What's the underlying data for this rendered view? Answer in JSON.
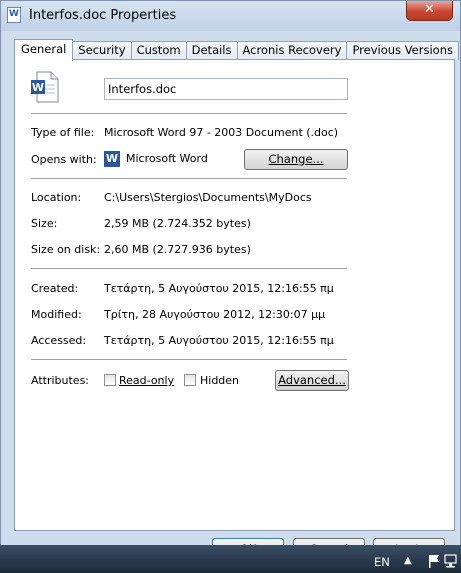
{
  "window": {
    "title": "Interfos.doc Properties",
    "close_glyph": "✕"
  },
  "tabs": [
    {
      "label": "General",
      "active": true
    },
    {
      "label": "Security"
    },
    {
      "label": "Custom"
    },
    {
      "label": "Details"
    },
    {
      "label": "Acronis Recovery"
    },
    {
      "label": "Previous Versions"
    }
  ],
  "general": {
    "filename": "Interfos.doc",
    "type_label": "Type of file:",
    "type_value": "Microsoft Word 97 - 2003 Document (.doc)",
    "opens_label": "Opens with:",
    "opens_value": "Microsoft Word",
    "change_button": "Change...",
    "location_label": "Location:",
    "location_value": "C:\\Users\\Stergios\\Documents\\MyDocs",
    "size_label": "Size:",
    "size_value": "2,59 MB (2.724.352 bytes)",
    "size_on_disk_label": "Size on disk:",
    "size_on_disk_value": "2,60 MB (2.727.936 bytes)",
    "created_label": "Created:",
    "created_value": "Τετάρτη, 5 Αυγούστου 2015, 12:16:55 πμ",
    "modified_label": "Modified:",
    "modified_value": "Τρίτη, 28 Αυγούστου 2012, 12:30:07 μμ",
    "accessed_label": "Accessed:",
    "accessed_value": "Τετάρτη, 5 Αυγούστου 2015, 12:16:55 πμ",
    "attributes_label": "Attributes:",
    "readonly_label": "Read-only",
    "hidden_label": "Hidden",
    "advanced_button": "Advanced..."
  },
  "dialog_buttons": {
    "ok": "OK",
    "cancel": "Cancel",
    "apply": "Apply"
  },
  "taskbar": {
    "language": "EN"
  },
  "colors": {
    "frame": "#cfdcec",
    "close": "#c8462f",
    "word_blue": "#2b579a"
  }
}
